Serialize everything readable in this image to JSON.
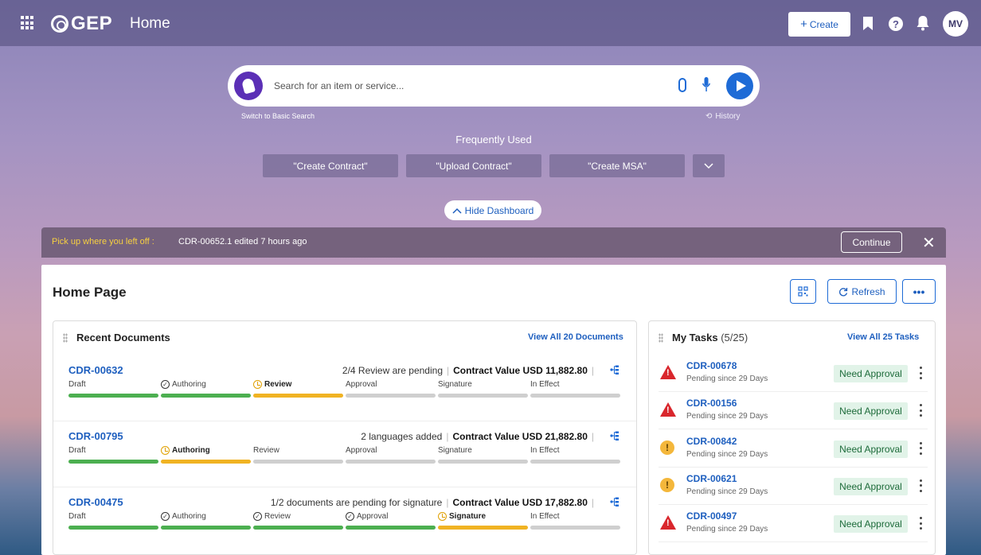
{
  "header": {
    "logo": "GEP",
    "title": "Home",
    "create_label": "Create",
    "avatar_initials": "MV"
  },
  "search": {
    "placeholder": "Search for an item or service...",
    "basic_search_link": "Switch to Basic Search",
    "history_label": "History"
  },
  "frequently_used": {
    "title": "Frequently Used",
    "items": [
      "\"Create Contract\"",
      "\"Upload Contract\"",
      "\"Create MSA\""
    ]
  },
  "dashboard_toggle": "Hide Dashboard",
  "resume": {
    "label": "Pick up where you left off :",
    "text": "CDR-00652.1 edited 7 hours ago",
    "continue_label": "Continue"
  },
  "home": {
    "title": "Home Page",
    "refresh_label": "Refresh"
  },
  "recent_documents": {
    "title": "Recent Documents",
    "view_all": "View All 20 Documents",
    "stage_names": [
      "Draft",
      "Authoring",
      "Review",
      "Approval",
      "Signature",
      "In Effect"
    ],
    "docs": [
      {
        "id": "CDR-00632",
        "status": "2/4 Review are pending",
        "value": "Contract Value USD 11,882.80",
        "states": [
          "done",
          "done",
          "current",
          "pending",
          "pending",
          "pending"
        ]
      },
      {
        "id": "CDR-00795",
        "status": "2 languages added",
        "value": "Contract Value USD 21,882.80",
        "states": [
          "done",
          "current",
          "pending",
          "pending",
          "pending",
          "pending"
        ]
      },
      {
        "id": "CDR-00475",
        "status": "1/2 documents are pending for signature",
        "value": "Contract Value USD 17,882.80",
        "states": [
          "done",
          "done",
          "done",
          "done",
          "current",
          "pending"
        ]
      }
    ]
  },
  "tasks": {
    "title": "My Tasks",
    "count": "(5/25)",
    "view_all": "View All 25 Tasks",
    "items": [
      {
        "id": "CDR-00678",
        "sub": "Pending since 29 Days",
        "badge": "Need Approval",
        "severity": "high"
      },
      {
        "id": "CDR-00156",
        "sub": "Pending since 29 Days",
        "badge": "Need Approval",
        "severity": "high"
      },
      {
        "id": "CDR-00842",
        "sub": "Pending since 29 Days",
        "badge": "Need Approval",
        "severity": "medium"
      },
      {
        "id": "CDR-00621",
        "sub": "Pending since 29 Days",
        "badge": "Need Approval",
        "severity": "medium"
      },
      {
        "id": "CDR-00497",
        "sub": "Pending since 29 Days",
        "badge": "Need Approval",
        "severity": "high"
      }
    ]
  },
  "icons": {
    "apps": "grid-icon",
    "bookmark": "bookmark-icon",
    "help": "help-icon",
    "notifications": "bell-icon",
    "attach": "paperclip-icon",
    "mic": "mic-icon",
    "send": "send-icon",
    "history": "history-icon",
    "close": "close-icon"
  },
  "colors": {
    "accent": "#1e6bd6",
    "done": "#4caf50",
    "current": "#f0b323",
    "pending": "#cfcfcf",
    "danger": "#d9262c",
    "warning": "#f4b73b"
  }
}
